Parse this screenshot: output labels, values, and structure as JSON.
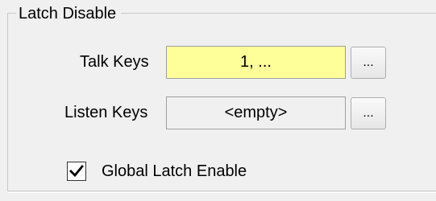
{
  "group": {
    "title": "Latch Disable"
  },
  "talk_keys": {
    "label": "Talk Keys",
    "value": "1, ...",
    "browse_label": "...",
    "highlight_color": "#ffff99"
  },
  "listen_keys": {
    "label": "Listen Keys",
    "value": "<empty>",
    "browse_label": "..."
  },
  "global_latch": {
    "label": "Global Latch Enable",
    "checked": true,
    "check_icon": "checkmark-icon"
  }
}
